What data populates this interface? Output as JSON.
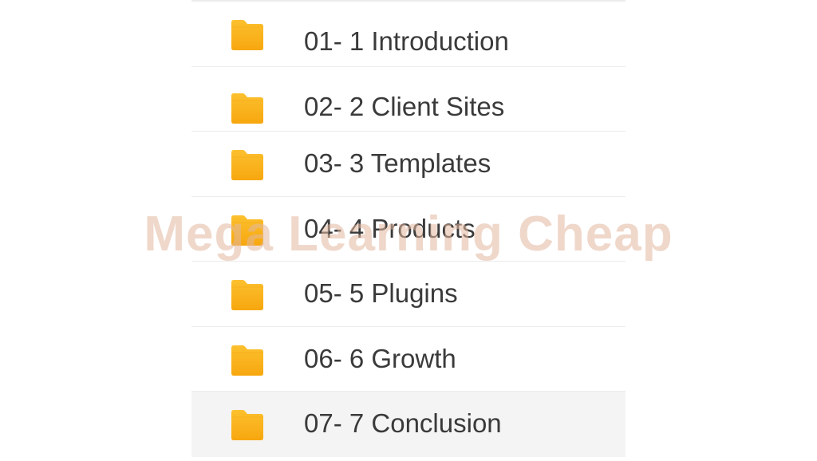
{
  "folders": [
    {
      "label": "01- 1 Introduction",
      "icon": "folder-icon"
    },
    {
      "label": "02- 2 Client Sites",
      "icon": "folder-icon"
    },
    {
      "label": "03- 3 Templates",
      "icon": "folder-icon"
    },
    {
      "label": "04- 4 Products",
      "icon": "folder-icon"
    },
    {
      "label": "05- 5 Plugins",
      "icon": "folder-icon"
    },
    {
      "label": "06- 6 Growth",
      "icon": "folder-icon"
    },
    {
      "label": "07- 7 Conclusion",
      "icon": "folder-icon",
      "selected": true
    }
  ],
  "watermark": "Mega Learning Cheap",
  "colors": {
    "folder_top": "#fbbf24",
    "folder_bottom": "#f59e0b",
    "text": "#3a3a3a",
    "divider": "#ececec",
    "selected_bg": "#f4f4f4",
    "watermark": "#e3b8a0"
  }
}
